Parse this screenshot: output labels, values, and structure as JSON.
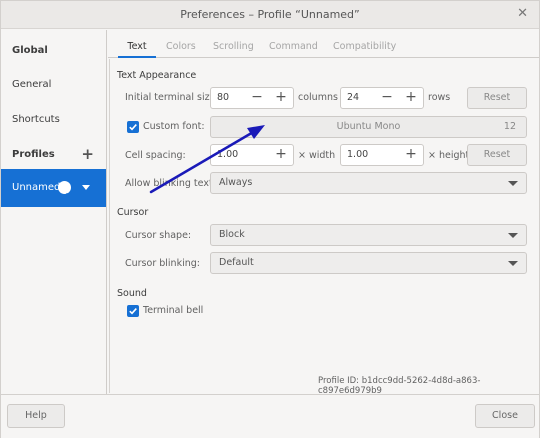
{
  "window": {
    "title": "Preferences – Profile “Unnamed”"
  },
  "sidebar": {
    "global": "Global",
    "general": "General",
    "shortcuts": "Shortcuts",
    "profiles": "Profiles",
    "profile_name": "Unnamed"
  },
  "tabs": [
    "Text",
    "Colors",
    "Scrolling",
    "Command",
    "Compatibility"
  ],
  "text_appearance": {
    "heading": "Text Appearance",
    "size_label": "Initial terminal size:",
    "columns_value": "80",
    "columns_unit": "columns",
    "rows_value": "24",
    "rows_unit": "rows",
    "reset": "Reset",
    "custom_font_label": "Custom font:",
    "font_name": "Ubuntu Mono",
    "font_size": "12",
    "cell_spacing_label": "Cell spacing:",
    "width_value": "1.00",
    "width_unit": "× width",
    "height_value": "1.00",
    "height_unit": "× height",
    "blinking_label": "Allow blinking text:",
    "blinking_value": "Always"
  },
  "cursor": {
    "heading": "Cursor",
    "shape_label": "Cursor shape:",
    "shape_value": "Block",
    "blinking_label": "Cursor blinking:",
    "blinking_value": "Default"
  },
  "sound": {
    "heading": "Sound",
    "bell_label": "Terminal bell"
  },
  "profile_id": "Profile ID:  b1dcc9dd-5262-4d8d-a863-c897e6d979b9",
  "footer": {
    "help": "Help",
    "close": "Close"
  },
  "colors": {
    "accent": "#1670d4",
    "annotation_arrow": "#1a1ab8"
  }
}
